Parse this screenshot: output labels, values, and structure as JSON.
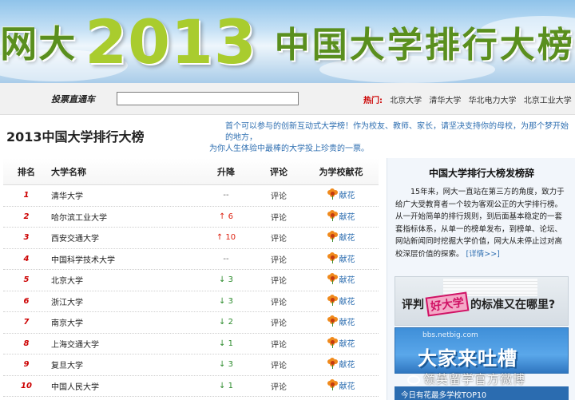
{
  "banner": {
    "prefix": "网大",
    "year": "2013",
    "title": "中国大学排行大榜"
  },
  "search": {
    "logo_text": "投票直通车",
    "input_value": "",
    "hot_label": "热门:",
    "hot_links": [
      "北京大学",
      "清华大学",
      "华北电力大学",
      "北京工业大学"
    ]
  },
  "header": {
    "page_title": "2013中国大学排行大榜",
    "intro_line1": "首个可以参与的创新互动式大学榜！作为校友、教师、家长，请坚决支持你的母校，为那个梦开始的地方，",
    "intro_line2": "为你人生体验中最棒的大学投上珍贵的一票。"
  },
  "table": {
    "headers": {
      "rank": "排名",
      "name": "大学名称",
      "change": "升降",
      "comment": "评论",
      "flower": "为学校献花"
    },
    "rows": [
      {
        "rank": "1",
        "name": "清华大学",
        "change": "--",
        "dir": "same",
        "comment": "评论",
        "flower": "献花"
      },
      {
        "rank": "2",
        "name": "哈尔滨工业大学",
        "change": "↑ 6",
        "dir": "up",
        "comment": "评论",
        "flower": "献花"
      },
      {
        "rank": "3",
        "name": "西安交通大学",
        "change": "↑ 10",
        "dir": "up",
        "comment": "评论",
        "flower": "献花"
      },
      {
        "rank": "4",
        "name": "中国科学技术大学",
        "change": "--",
        "dir": "same",
        "comment": "评论",
        "flower": "献花"
      },
      {
        "rank": "5",
        "name": "北京大学",
        "change": "↓ 3",
        "dir": "down",
        "comment": "评论",
        "flower": "献花"
      },
      {
        "rank": "6",
        "name": "浙江大学",
        "change": "↓ 3",
        "dir": "down",
        "comment": "评论",
        "flower": "献花"
      },
      {
        "rank": "7",
        "name": "南京大学",
        "change": "↓ 2",
        "dir": "down",
        "comment": "评论",
        "flower": "献花"
      },
      {
        "rank": "8",
        "name": "上海交通大学",
        "change": "↓ 1",
        "dir": "down",
        "comment": "评论",
        "flower": "献花"
      },
      {
        "rank": "9",
        "name": "复旦大学",
        "change": "↓ 3",
        "dir": "down",
        "comment": "评论",
        "flower": "献花"
      },
      {
        "rank": "10",
        "name": "中国人民大学",
        "change": "↓ 1",
        "dir": "down",
        "comment": "评论",
        "flower": "献花"
      }
    ]
  },
  "sidebar": {
    "title": "中国大学排行大榜发榜辞",
    "text": "15年来，网大一直站在第三方的角度，致力于给广大受教育者一个较为客观公正的大学排行榜。从一开始简单的排行规则，到后面基本稳定的一套套指标体系，从单一的榜单发布，到榜单、论坛、网站新闻同时挖掘大学价值，网大从未停止过对高校深层价值的探索。",
    "detail_link": "[详情>>]",
    "ad1_prefix": "评判",
    "ad1_badge": "好大学",
    "ad1_suffix": "的标准又在哪里?",
    "ad2_url": "bbs.netbig.com",
    "ad2_text": "大家来吐槽",
    "ad3_text": "今日有花最多学校TOP10"
  },
  "watermark": {
    "text": "领英留学官方微博"
  },
  "colors": {
    "banner_green": "#5a8f1e",
    "year_green": "#a9cc2e",
    "rank_red": "#cc0000",
    "up_red": "#dd2211",
    "down_green": "#2a8a2a",
    "link_blue": "#2f6fb1"
  }
}
